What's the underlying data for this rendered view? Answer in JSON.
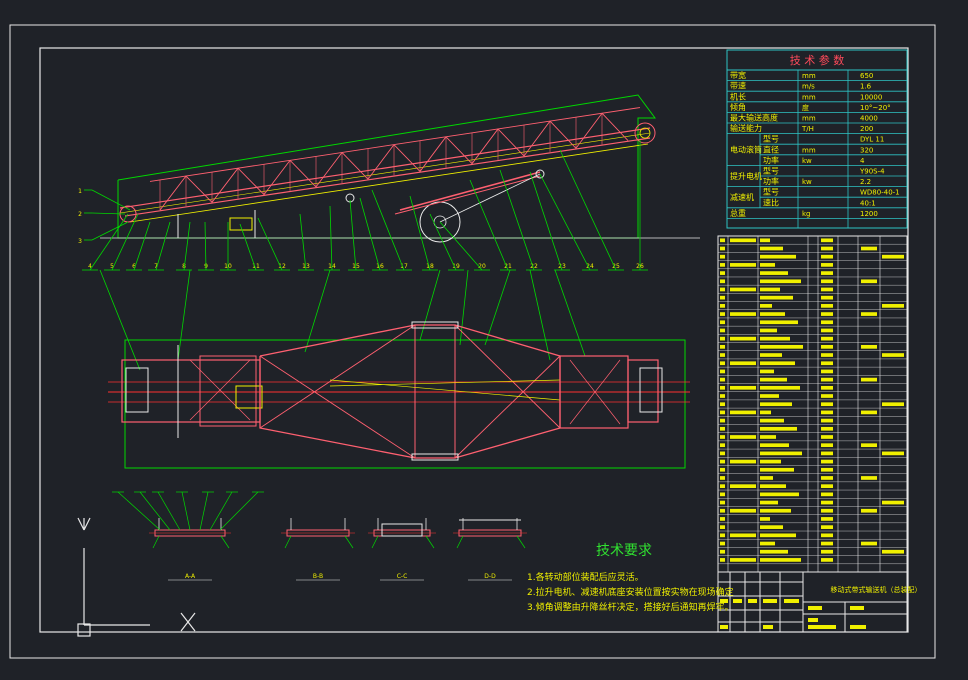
{
  "colors": {
    "background": "#1f2228",
    "frame": "#e8e8e8",
    "table": "#2ec4c4",
    "text_yellow": "#f0f000",
    "leader": "#00d800",
    "structure": "#ff6070",
    "centerline": "#ff3030",
    "heading_green": "#30e030"
  },
  "params_table": {
    "title": "技 术 参 数",
    "rows": [
      {
        "name": "带宽",
        "unit": "mm",
        "value": "650"
      },
      {
        "name": "带速",
        "unit": "m/s",
        "value": "1.6"
      },
      {
        "name": "机长",
        "unit": "mm",
        "value": "10000"
      },
      {
        "name": "倾角",
        "unit": "度",
        "value": "10°~20°"
      },
      {
        "name": "最大输送高度",
        "unit": "mm",
        "value": "4000"
      },
      {
        "name": "输送能力",
        "unit": "T/H",
        "value": "200"
      }
    ],
    "groups": [
      {
        "group": "电动滚筒",
        "rows": [
          {
            "name": "型号",
            "unit": "",
            "value": "DYL 11"
          },
          {
            "name": "直径",
            "unit": "mm",
            "value": "320"
          },
          {
            "name": "功率",
            "unit": "kw",
            "value": "4"
          }
        ]
      },
      {
        "group": "提升电机",
        "rows": [
          {
            "name": "型号",
            "unit": "",
            "value": "Y90S-4"
          },
          {
            "name": "功率",
            "unit": "kw",
            "value": "2.2"
          }
        ]
      },
      {
        "group": "减速机",
        "rows": [
          {
            "name": "型号",
            "unit": "",
            "value": "WD80-40-1"
          },
          {
            "name": "速比",
            "unit": "",
            "value": "40:1"
          }
        ]
      }
    ],
    "total": {
      "name": "总重",
      "unit": "kg",
      "value": "1200"
    }
  },
  "part_numbers_top": [
    "1",
    "2",
    "3"
  ],
  "part_numbers_row": [
    "4",
    "5",
    "6",
    "7",
    "8",
    "9",
    "10",
    "11",
    "12",
    "13",
    "14",
    "15",
    "16",
    "17",
    "18",
    "19",
    "20",
    "21",
    "22",
    "23",
    "24",
    "25",
    "26"
  ],
  "section_labels": [
    "A-A",
    "B-B",
    "C-C",
    "D-D"
  ],
  "requirements": {
    "heading": "技术要求",
    "items": [
      "1.各转动部位装配后应灵活。",
      "2.拉升电机、减速机底座安装位置按实物在现场确定",
      "3.倾角调整由升降丝杆决定，搭接好后通知再焊牢。"
    ]
  },
  "title_block": {
    "title": "移动式带式输送机（总装配）"
  },
  "ucs": {
    "y_axis": "Y",
    "x_axis": "X"
  }
}
